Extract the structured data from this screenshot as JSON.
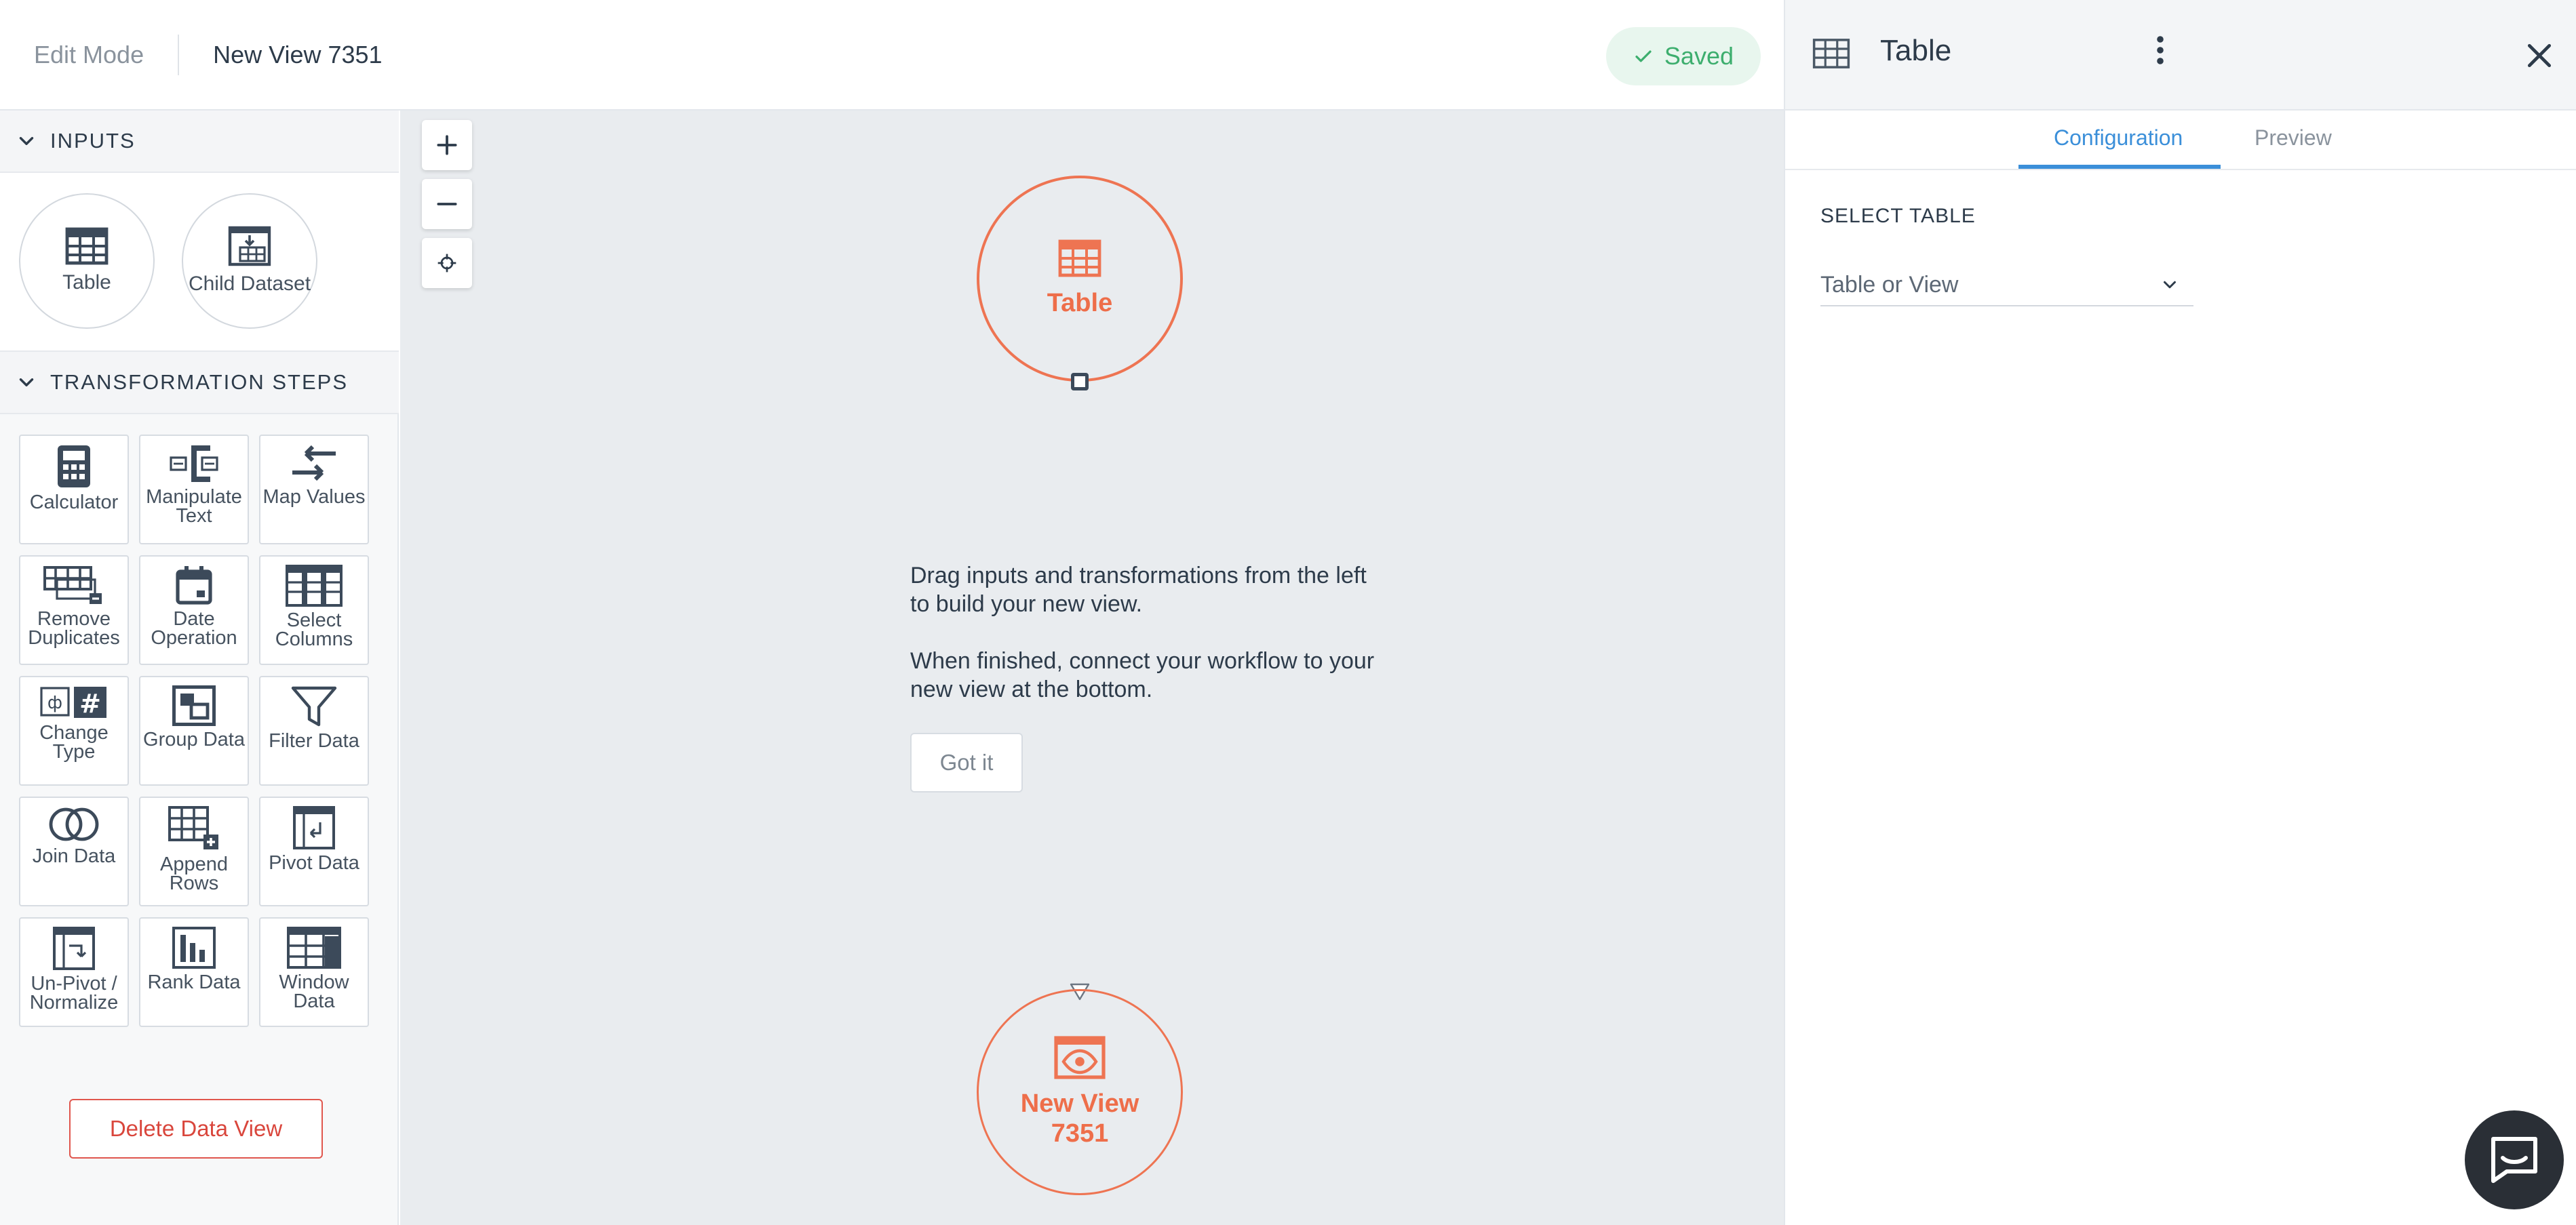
{
  "topbar": {
    "mode": "Edit Mode",
    "view_title": "New View 7351",
    "saved_label": "Saved"
  },
  "sidebar": {
    "inputs_heading": "INPUTS",
    "inputs": [
      {
        "label": "Table",
        "icon": "table-icon"
      },
      {
        "label": "Child Dataset",
        "icon": "child-dataset-icon"
      }
    ],
    "steps_heading": "TRANSFORMATION STEPS",
    "steps": [
      {
        "label": "Calculator",
        "icon": "calculator-icon"
      },
      {
        "label": "Manipulate Text",
        "icon": "manipulate-text-icon"
      },
      {
        "label": "Map Values",
        "icon": "map-values-icon"
      },
      {
        "label": "Remove Duplicates",
        "icon": "remove-duplicates-icon"
      },
      {
        "label": "Date Operation",
        "icon": "calendar-icon"
      },
      {
        "label": "Select Columns",
        "icon": "columns-icon"
      },
      {
        "label": "Change Type",
        "icon": "change-type-icon"
      },
      {
        "label": "Group Data",
        "icon": "group-data-icon"
      },
      {
        "label": "Filter Data",
        "icon": "filter-icon"
      },
      {
        "label": "Join Data",
        "icon": "join-icon"
      },
      {
        "label": "Append Rows",
        "icon": "append-rows-icon"
      },
      {
        "label": "Pivot Data",
        "icon": "pivot-icon"
      },
      {
        "label": "Un-Pivot / Normalize",
        "icon": "unpivot-icon"
      },
      {
        "label": "Rank Data",
        "icon": "rank-chart-icon"
      },
      {
        "label": "Window Data",
        "icon": "window-data-icon"
      }
    ],
    "delete_label": "Delete Data View"
  },
  "canvas": {
    "source_node_label": "Table",
    "output_node_label": "New View 7351",
    "hint_line_1": "Drag inputs and transformations from the left to build your new view.",
    "hint_line_2": "When finished, connect your workflow to your new view at the bottom.",
    "got_it_label": "Got it"
  },
  "panel": {
    "title": "Table",
    "tabs": [
      {
        "label": "Configuration",
        "active": true
      },
      {
        "label": "Preview",
        "active": false
      }
    ],
    "select_label": "SELECT TABLE",
    "select_placeholder": "Table or View"
  },
  "colors": {
    "accent_orange": "#ee7452",
    "accent_blue": "#3b8fd9",
    "saved_green": "#3dae6e",
    "danger_red": "#d9463c"
  }
}
